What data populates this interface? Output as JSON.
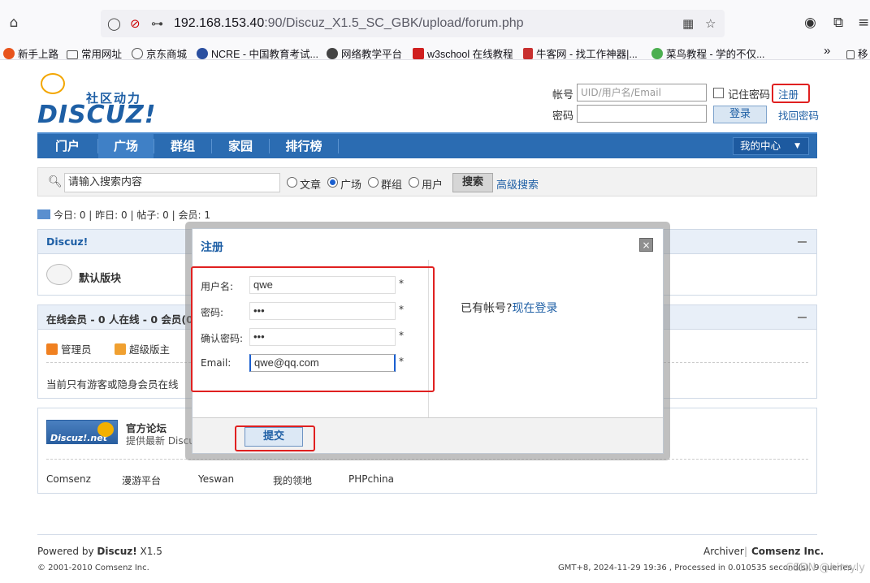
{
  "browser": {
    "url_host": "192.168.153.40",
    "url_rest": ":90/Discuz_X1.5_SC_GBK/upload/forum.php",
    "bookmarks": [
      "新手上路",
      "常用网址",
      "京东商城",
      "NCRE - 中国教育考试...",
      "网络教学平台",
      "w3school 在线教程",
      "牛客网 - 找工作神器|...",
      "菜鸟教程 - 学的不仅...",
      "移"
    ]
  },
  "logo": {
    "slogan": "社区动力",
    "word": "DISCUZ!"
  },
  "login": {
    "account_label": "帐号",
    "account_placeholder": "UID/用户名/Email",
    "remember_label": "记住密码",
    "register_link": "注册",
    "password_label": "密码",
    "login_button": "登录",
    "forgot_link": "找回密码"
  },
  "nav": {
    "items": [
      "门户",
      "广场",
      "群组",
      "家园",
      "排行榜"
    ],
    "active": "广场",
    "my_center": "我的中心"
  },
  "search": {
    "placeholder": "请输入搜索内容",
    "options": [
      "文章",
      "广场",
      "群组",
      "用户"
    ],
    "selected": "广场",
    "button": "搜索",
    "advanced": "高级搜索"
  },
  "stats": {
    "text": "今日: 0 | 昨日: 0 | 帖子: 0 | 会员: 1"
  },
  "forum_panel": {
    "title": "Discuz!",
    "forum_name": "默认版块"
  },
  "online_panel": {
    "title": "在线会员 - 0 人在线 - 0 会员(0",
    "legend": [
      "管理员",
      "超级版主"
    ],
    "note": "当前只有游客或隐身会员在线"
  },
  "links_panel": {
    "logo_text": "Discuz!.net",
    "title": "官方论坛",
    "desc": "提供最新 Discu",
    "links": [
      "Comsenz",
      "漫游平台",
      "Yeswan",
      "我的领地",
      "PHPchina"
    ]
  },
  "footer": {
    "powered_prefix": "Powered by ",
    "powered_brand": "Discuz!",
    "powered_ver": " X1.5",
    "copyright": "© 2001-2010 Comsenz Inc.",
    "archiver": "Archiver",
    "company": "Comsenz Inc.",
    "processed": "GMT+8, 2024-11-29 19:36 , Processed in 0.010535 second(s), 9 queries ."
  },
  "modal": {
    "title": "注册",
    "close": "×",
    "fields": [
      {
        "label": "用户名:",
        "value": "qwe"
      },
      {
        "label": "密码:",
        "value": "•••"
      },
      {
        "label": "确认密码:",
        "value": "•••"
      },
      {
        "label": "Email:",
        "value": "qwe@qq.com"
      }
    ],
    "required_mark": "*",
    "has_account": "已有帐号?",
    "login_now": "现在登录",
    "submit": "提交"
  },
  "watermark": "CSDN @himyly",
  "colors": {
    "brand_blue": "#2b6cb2",
    "link_blue": "#1e5fa5",
    "annotation_red": "#e02020"
  }
}
